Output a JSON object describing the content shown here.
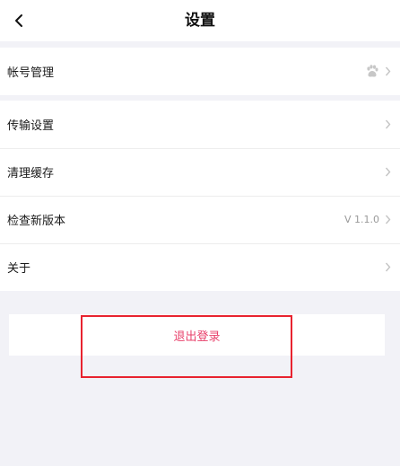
{
  "header": {
    "title": "设置"
  },
  "account_section": {
    "items": [
      {
        "label": "帐号管理",
        "icon": "paw-icon"
      }
    ]
  },
  "general_section": {
    "items": [
      {
        "label": "传输设置"
      },
      {
        "label": "清理缓存"
      },
      {
        "label": "检查新版本",
        "value": "V 1.1.0"
      },
      {
        "label": "关于"
      }
    ]
  },
  "logout": {
    "label": "退出登录",
    "color": "#e8416b"
  },
  "annotation": {
    "highlight_color": "#e8232f"
  }
}
